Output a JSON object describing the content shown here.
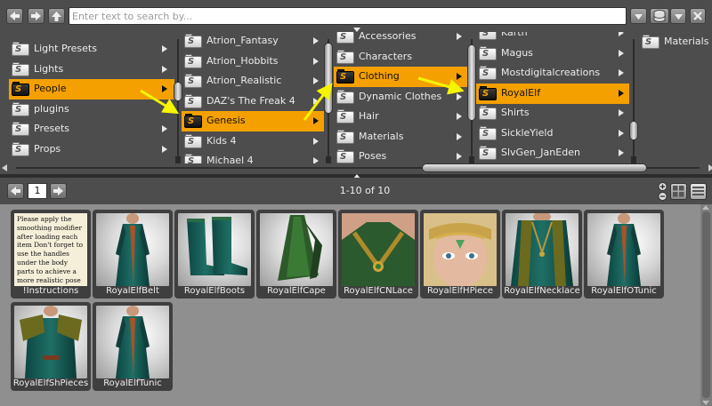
{
  "toolbar": {
    "search_placeholder": "Enter text to search by..."
  },
  "columns": [
    {
      "items": [
        {
          "label": "Light Presets",
          "arrow": true,
          "selected": false
        },
        {
          "label": "Lights",
          "arrow": true,
          "selected": false
        },
        {
          "label": "People",
          "arrow": true,
          "selected": true
        },
        {
          "label": "plugins",
          "arrow": false,
          "selected": false
        },
        {
          "label": "Presets",
          "arrow": true,
          "selected": false
        },
        {
          "label": "Props",
          "arrow": true,
          "selected": false
        }
      ]
    },
    {
      "items": [
        {
          "label": "Atrion_Fantasy",
          "arrow": true,
          "selected": false
        },
        {
          "label": "Atrion_Hobbits",
          "arrow": true,
          "selected": false
        },
        {
          "label": "Atrion_Realistic",
          "arrow": true,
          "selected": false
        },
        {
          "label": "DAZ's The Freak 4",
          "arrow": true,
          "selected": false
        },
        {
          "label": "Genesis",
          "arrow": true,
          "selected": true
        },
        {
          "label": "Kids 4",
          "arrow": true,
          "selected": false
        },
        {
          "label": "Michael 4",
          "arrow": true,
          "selected": false
        }
      ]
    },
    {
      "items": [
        {
          "label": "Accessories",
          "arrow": true,
          "selected": false
        },
        {
          "label": "Characters",
          "arrow": false,
          "selected": false
        },
        {
          "label": "Clothing",
          "arrow": true,
          "selected": true
        },
        {
          "label": "Dynamic Clothes",
          "arrow": true,
          "selected": false
        },
        {
          "label": "Hair",
          "arrow": true,
          "selected": false
        },
        {
          "label": "Materials",
          "arrow": true,
          "selected": false
        },
        {
          "label": "Poses",
          "arrow": true,
          "selected": false
        }
      ]
    },
    {
      "items": [
        {
          "label": "Karth",
          "arrow": true,
          "selected": false
        },
        {
          "label": "Magus",
          "arrow": true,
          "selected": false
        },
        {
          "label": "Mostdigitalcreations",
          "arrow": true,
          "selected": false
        },
        {
          "label": "RoyalElf",
          "arrow": true,
          "selected": true
        },
        {
          "label": "Shirts",
          "arrow": true,
          "selected": false
        },
        {
          "label": "SickleYield",
          "arrow": true,
          "selected": false
        },
        {
          "label": "SlvGen_JanEden",
          "arrow": true,
          "selected": false
        }
      ]
    },
    {
      "items": [
        {
          "label": "Materials",
          "arrow": false,
          "selected": false
        }
      ]
    }
  ],
  "pager": {
    "page": "1",
    "count": "1-10 of 10"
  },
  "instructions_text": "Please apply the smoothing modifier after loading each item Don't forget to use the handles under the body parts to achieve a more realistic pose",
  "items": [
    {
      "label": "!Instructions",
      "kind": "instructions"
    },
    {
      "label": "RoyalElfBelt",
      "kind": "robe"
    },
    {
      "label": "RoyalElfBoots",
      "kind": "boots"
    },
    {
      "label": "RoyalElfCape",
      "kind": "cape"
    },
    {
      "label": "RoyalElfCNLace",
      "kind": "necklace-close"
    },
    {
      "label": "RoyalElfHPiece",
      "kind": "face"
    },
    {
      "label": "RoyalElfNecklace",
      "kind": "necklace"
    },
    {
      "label": "RoyalElfOTunic",
      "kind": "robe"
    },
    {
      "label": "RoyalElfShPieces",
      "kind": "shoulders"
    },
    {
      "label": "RoyalElfTunic",
      "kind": "robe-full"
    }
  ],
  "colors": {
    "selection": "#f4a000",
    "panel": "#4d4d4d",
    "content_bg": "#8f8f8f",
    "annotation_arrow": "#f5f500"
  }
}
